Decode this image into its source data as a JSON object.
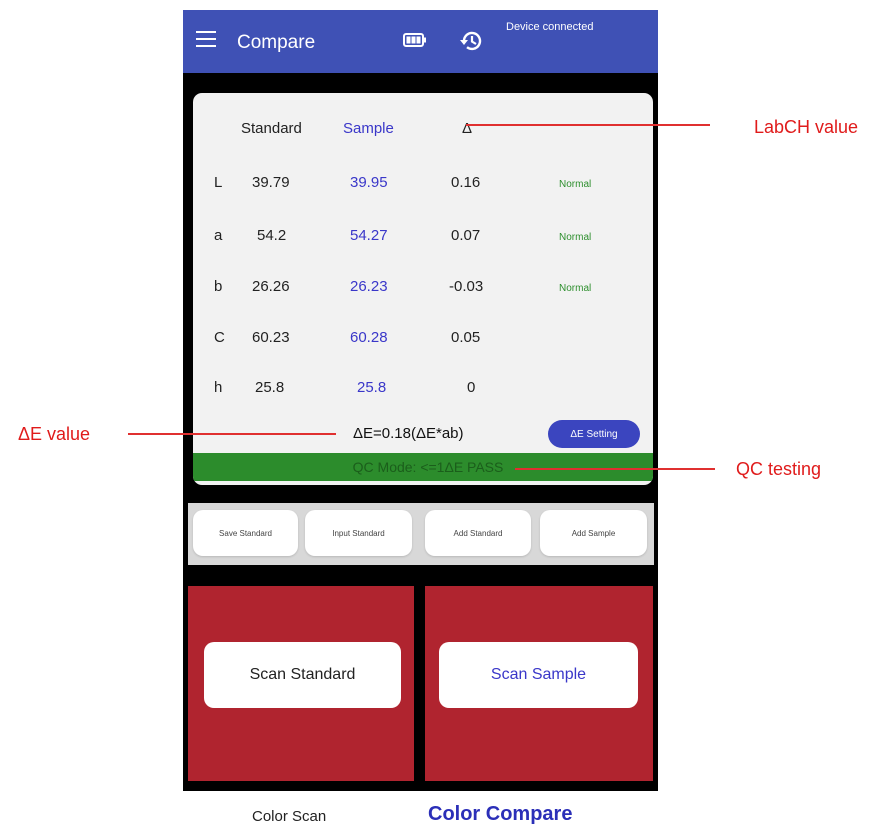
{
  "app": {
    "title": "Compare",
    "device_status": "Device connected"
  },
  "table": {
    "headers": [
      "Standard",
      "Sample",
      "Δ"
    ],
    "rows": [
      {
        "label": "L",
        "standard": "39.79",
        "sample": "39.95",
        "delta": "0.16",
        "status": "Normal"
      },
      {
        "label": "a",
        "standard": "54.2",
        "sample": "54.27",
        "delta": "0.07",
        "status": "Normal"
      },
      {
        "label": "b",
        "standard": "26.26",
        "sample": "26.23",
        "delta": "-0.03",
        "status": "Normal"
      },
      {
        "label": "C",
        "standard": "60.23",
        "sample": "60.28",
        "delta": "0.05",
        "status": ""
      },
      {
        "label": "h",
        "standard": "25.8",
        "sample": "25.8",
        "delta": "0",
        "status": ""
      }
    ]
  },
  "delta_e": {
    "text": "ΔE=0.18(ΔE*ab)",
    "setting_button": "ΔE Setting"
  },
  "qc": {
    "text": "QC Mode: <=1ΔE  PASS"
  },
  "actions": [
    "Save Standard",
    "Input Standard",
    "Add Standard",
    "Add Sample"
  ],
  "scan": {
    "standard_label": "Scan Standard",
    "sample_label": "Scan Sample"
  },
  "annotations": {
    "labch": "LabCH value",
    "delta_e": "ΔE value",
    "qc": "QC testing"
  },
  "bottom_tabs": {
    "color_scan": "Color Scan",
    "color_compare": "Color Compare"
  },
  "colors": {
    "topbar": "#3f51b5",
    "sample_text": "#3a37c9",
    "qc_bar": "#2c8c2c",
    "scan_panel": "#b0242f",
    "annotation": "#e01b1b"
  }
}
